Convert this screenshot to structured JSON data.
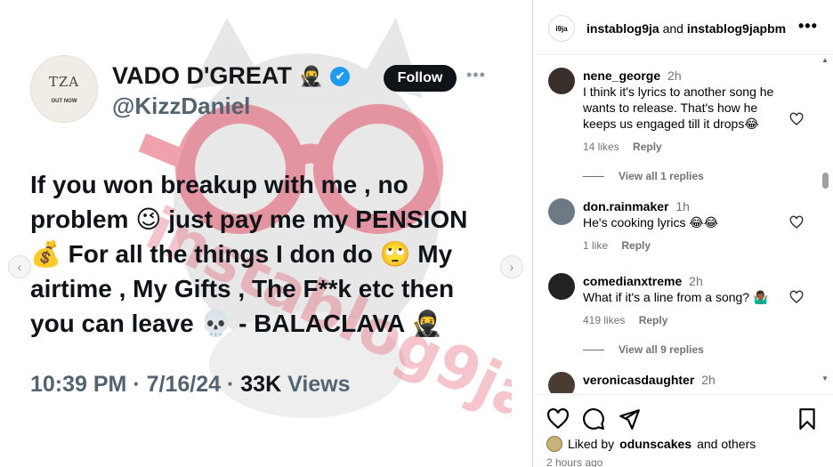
{
  "post": {
    "watermark_text": "instablog9ja",
    "tweet": {
      "avatar_logo": "TZA",
      "avatar_caption": "OUT NOW",
      "name": "VADO D'GREAT",
      "name_emoji": "🥷",
      "verified_mark": "✔",
      "handle": "@KizzDaniel",
      "follow_label": "Follow",
      "more_label": "•••",
      "text": "If you won breakup with me , no problem 😉 just pay me my PENSION 💰 For all the things I don do 🙄 My airtime , My Gifts , The F**k etc then you can leave 💀 - BALACLAVA 🥷",
      "time": "10:39 PM",
      "date": "7/16/24",
      "views_count": "33K",
      "views_label": "Views"
    },
    "nav": {
      "prev": "‹",
      "next": "›"
    }
  },
  "header": {
    "avatar_text": "i9ja",
    "user1": "instablog9ja",
    "conjunction": "and",
    "user2": "instablog9japbm",
    "more": "•••"
  },
  "comments": [
    {
      "user": "nene_george",
      "time": "2h",
      "text": "I think it's lyrics to another song he wants to release. That's how he keeps us engaged till it drops😂",
      "likes": "14 likes",
      "reply": "Reply",
      "avatar_color": "#3a2f2a"
    },
    {
      "user": "don.rainmaker",
      "time": "1h",
      "text": "He's cooking lyrics 😂😂",
      "likes": "1 like",
      "reply": "Reply",
      "avatar_color": "#6c7a86"
    },
    {
      "user": "comedianxtreme",
      "time": "2h",
      "text": "What if it's a line from a song? 🤷🏾‍♂️",
      "likes": "419 likes",
      "reply": "Reply",
      "avatar_color": "#222222"
    },
    {
      "user": "veronicasdaughter",
      "time": "2h",
      "text": "",
      "likes": "",
      "reply": "",
      "avatar_color": "#4a3b33"
    }
  ],
  "view_replies": [
    {
      "label": "View all 1 replies"
    },
    {
      "label": "View all 9 replies"
    }
  ],
  "liked": {
    "prefix": "Liked by",
    "user": "odunscakes",
    "suffix": "and others"
  },
  "time_ago": "2 hours ago",
  "colors": {
    "watermark_red": "#e0304a",
    "watermark_gray": "#d4d4d4",
    "verified_blue": "#1d9bf0"
  }
}
